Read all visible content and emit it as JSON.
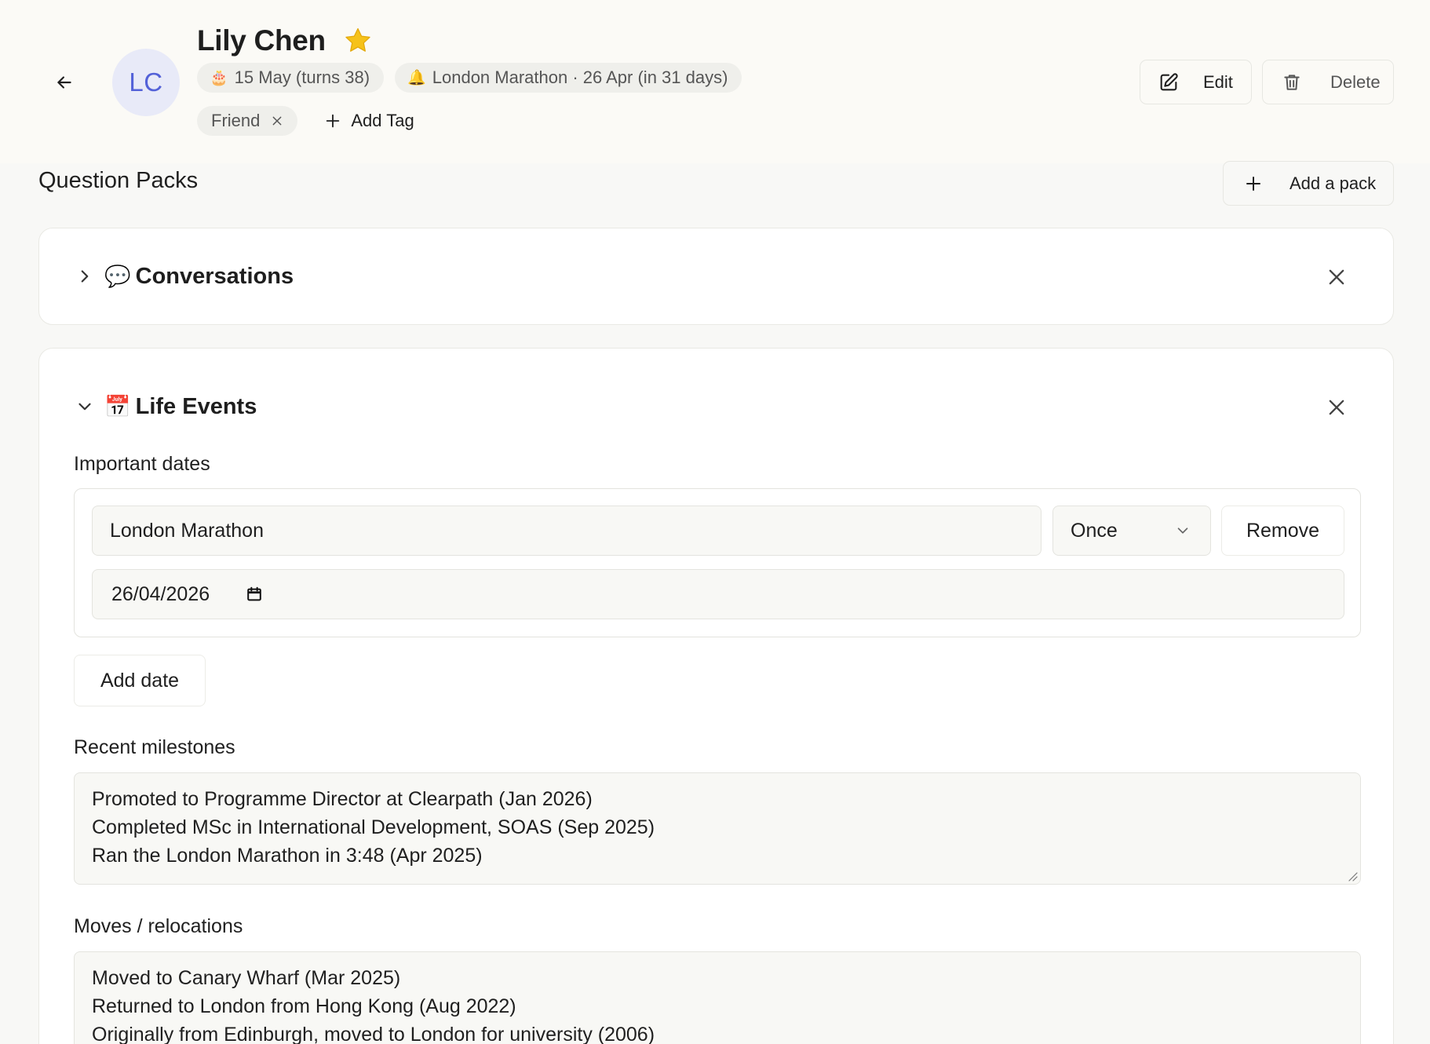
{
  "contact": {
    "initials": "LC",
    "name": "Lily Chen",
    "birthday_chip": {
      "icon": "birthday-cake-icon",
      "emoji": "🎂",
      "text": "15 May (turns 38)"
    },
    "reminder_chip": {
      "icon": "bell-icon",
      "emoji": "🔔",
      "text": "London Marathon · 26 Apr (in 31 days)"
    },
    "tags": [
      {
        "label": "Friend"
      }
    ],
    "add_tag_label": "Add Tag",
    "favorite_color": "#f6c21a"
  },
  "header": {
    "edit_label": "Edit",
    "delete_label": "Delete"
  },
  "section": {
    "title": "Question Packs",
    "add_pack_label": "Add a pack"
  },
  "packs": [
    {
      "emoji": "💬",
      "icon": "speech-bubble-icon",
      "title": "Conversations",
      "expanded": false
    },
    {
      "emoji": "📅",
      "icon": "calendar-icon",
      "title": "Life Events",
      "expanded": true,
      "important_dates_label": "Important dates",
      "dates": [
        {
          "name": "London Marathon",
          "repeat": "Once",
          "date": "26/04/2026",
          "remove_label": "Remove"
        }
      ],
      "add_date_label": "Add date",
      "milestones_label": "Recent milestones",
      "milestones": [
        "Promoted to Programme Director at Clearpath (Jan 2026)",
        "Completed MSc in International Development, SOAS (Sep 2025)",
        "Ran the London Marathon in 3:48 (Apr 2025)"
      ],
      "moves_label": "Moves / relocations",
      "moves": [
        "Moved to Canary Wharf (Mar 2025)",
        "Returned to London from Hong Kong (Aug 2022)",
        "Originally from Edinburgh, moved to London for university (2006)"
      ]
    }
  ],
  "colors": {
    "avatar_bg": "#e8eaf8",
    "avatar_text": "#5361d8",
    "page_bg": "#f8f8f6"
  }
}
